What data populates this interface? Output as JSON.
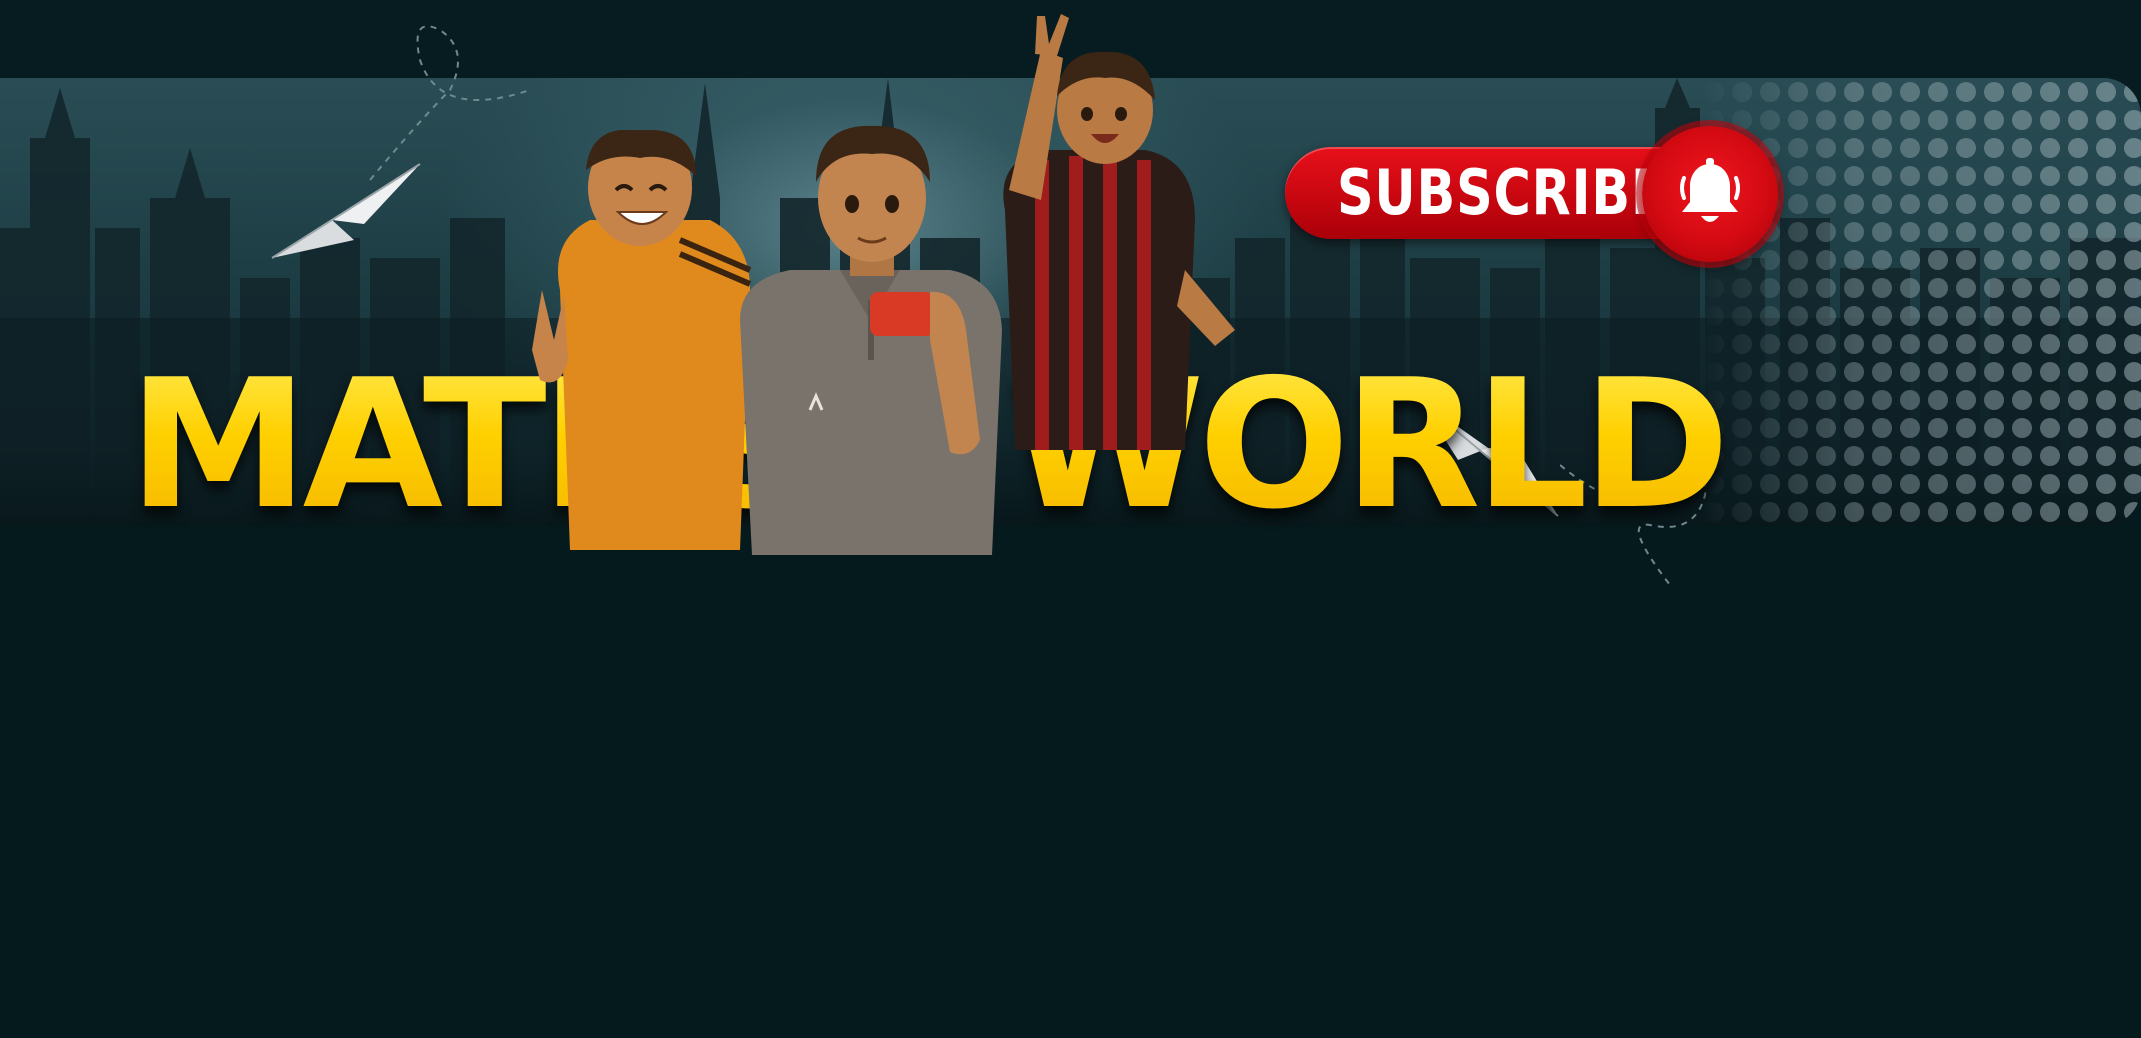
{
  "banner": {
    "title_left": "MATHS",
    "title_right": "WORLD",
    "subscribe_label": "SUBSCRIBE"
  },
  "icons": {
    "bell": "bell-icon",
    "planes": [
      "paper-plane-icon",
      "paper-plane-icon"
    ]
  },
  "colors": {
    "background": "#051a1e",
    "title_yellow": "#ffd400",
    "subscribe_red": "#d40a12"
  }
}
